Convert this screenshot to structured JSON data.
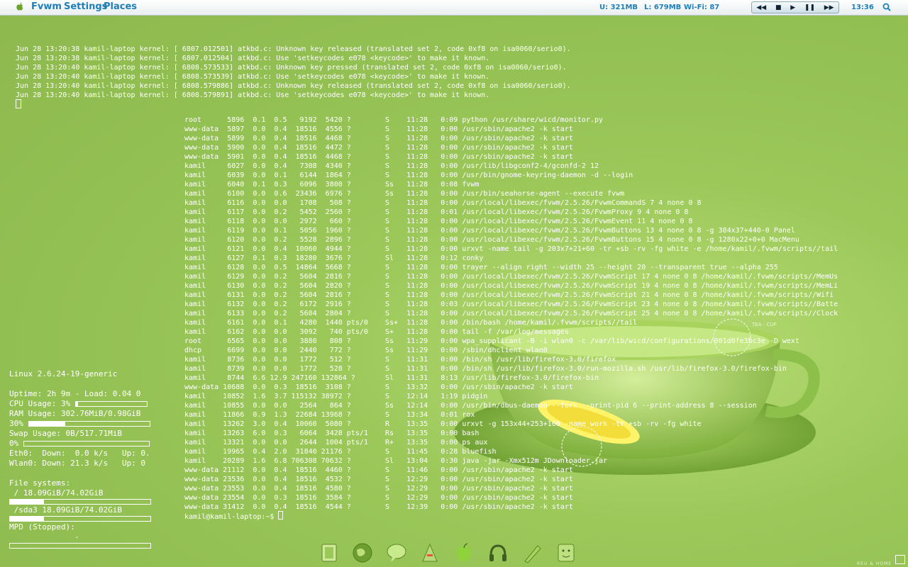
{
  "topbar": {
    "menus": [
      "Fvwm",
      "Settings",
      "Places"
    ],
    "user_mem": "U: 321MB",
    "load_mem": "L: 679MB",
    "wifi": "Wi-Fi: 87",
    "clock": "13:36",
    "media_buttons": [
      "rewind-icon",
      "stop-icon",
      "play-icon",
      "pause-icon",
      "forward-icon"
    ]
  },
  "kernel_log": [
    "Jun 28 13:20:38 kamil-laptop kernel: [ 6807.012501] atkbd.c: Unknown key released (translated set 2, code 0xf8 on isa0060/serio0).",
    "Jun 28 13:20:38 kamil-laptop kernel: [ 6807.012504] atkbd.c: Use 'setkeycodes e078 <keycode>' to make it known.",
    "Jun 28 13:20:40 kamil-laptop kernel: [ 6808.573533] atkbd.c: Unknown key pressed (translated set 2, code 0xf8 on isa0060/serio0).",
    "Jun 28 13:20:40 kamil-laptop kernel: [ 6808.573539] atkbd.c: Use 'setkeycodes e078 <keycode>' to make it known.",
    "Jun 28 13:20:40 kamil-laptop kernel: [ 6808.579886] atkbd.c: Unknown key released (translated set 2, code 0xf8 on isa0060/serio0).",
    "Jun 28 13:20:40 kamil-laptop kernel: [ 6808.579891] atkbd.c: Use 'setkeycodes e078 <keycode>' to make it known."
  ],
  "ps_output": [
    "root      5896  0.1  0.5   9192  5420 ?        S    11:28   0:09 python /usr/share/wicd/monitor.py",
    "www-data  5897  0.0  0.4  18516  4556 ?        S    11:28   0:00 /usr/sbin/apache2 -k start",
    "www-data  5899  0.0  0.4  18516  4468 ?        S    11:28   0:00 /usr/sbin/apache2 -k start",
    "www-data  5900  0.0  0.4  18516  4472 ?        S    11:28   0:00 /usr/sbin/apache2 -k start",
    "www-data  5901  0.0  0.4  18516  4468 ?        S    11:28   0:00 /usr/sbin/apache2 -k start",
    "kamil     6027  0.0  0.4   7308  4340 ?        S    11:28   0:00 /usr/lib/libgconf2-4/gconfd-2 12",
    "kamil     6039  0.0  0.1   6144  1864 ?        S    11:28   0:00 /usr/bin/gnome-keyring-daemon -d --login",
    "kamil     6040  0.1  0.3   6096  3800 ?        Ss   11:28   0:08 fvwm",
    "kamil     6100  0.0  0.6  23436  6976 ?        Ss   11:28   0:00 /usr/bin/seahorse-agent --execute fvwm",
    "kamil     6116  0.0  0.0   1708   508 ?        S    11:28   0:00 /usr/local/libexec/fvwm/2.5.26/FvwmCommandS 7 4 none 0 8",
    "kamil     6117  0.0  0.2   5452  2560 ?        S    11:28   0:01 /usr/local/libexec/fvwm/2.5.26/FvwmProxy 9 4 none 0 8",
    "kamil     6118  0.0  0.0   2972   660 ?        S    11:28   0:00 /usr/local/libexec/fvwm/2.5.26/FvwmEvent 11 4 none 0 8",
    "kamil     6119  0.0  0.1   5056  1960 ?        S    11:28   0:00 /usr/local/libexec/fvwm/2.5.26/FvwmButtons 13 4 none 0 8 -g 384x37+440-0 Panel",
    "kamil     6120  0.0  0.2   5528  2896 ?        S    11:28   0:00 /usr/local/libexec/fvwm/2.5.26/FvwmButtons 15 4 none 0 8 -g 1280x22+0+0 MacMenu",
    "kamil     6121  0.0  0.4  10060  4944 ?        S    11:28   0:00 urxvt -name tail -g 203x7+21+60 -tr +sb -rv -fg white -e /home/kamil/.fvwm/scripts//tail",
    "kamil     6127  0.1  0.3  18280  3676 ?        Sl   11:28   0:12 conky",
    "kamil     6128  0.0  0.5  14864  5668 ?        S    11:28   0:00 trayer --align right --width 25 --height 20 --transparent true --alpha 255",
    "kamil     6129  0.0  0.2   5604  2816 ?        S    11:28   0:00 /usr/local/libexec/fvwm/2.5.26/FvwmScript 17 4 none 0 8 /home/kamil/.fvwm/scripts//MemUs",
    "kamil     6130  0.0  0.2   5604  2820 ?        S    11:28   0:00 /usr/local/libexec/fvwm/2.5.26/FvwmScript 19 4 none 0 8 /home/kamil/.fvwm/scripts//MemLi",
    "kamil     6131  0.0  0.2   5604  2816 ?        S    11:28   0:00 /usr/local/libexec/fvwm/2.5.26/FvwmScript 21 4 none 0 8 /home/kamil/.fvwm/scripts//Wifi",
    "kamil     6132  0.0  0.2   6172  2916 ?        S    11:28   0:03 /usr/local/libexec/fvwm/2.5.26/FvwmScript 23 4 none 0 8 /home/kamil/.fvwm/scripts//Batte",
    "kamil     6133  0.0  0.2   5604  2804 ?        S    11:28   0:00 /usr/local/libexec/fvwm/2.5.26/FvwmScript 25 4 none 0 8 /home/kamil/.fvwm/scripts//Clock",
    "kamil     6161  0.0  0.1   4280  1440 pts/0    Ss+  11:28   0:00 /bin/bash /home/kamil/.fvwm/scripts//tail",
    "kamil     6162  0.0  0.0   3092   740 pts/0    S+   11:28   0:00 tail -f /var/log/messages",
    "root      6565  0.0  0.0   3880   808 ?        Ss   11:29   0:00 wpa_supplicant -B -i wlan0 -c /var/lib/wicd/configurations/001d0fe3bc3e -D wext",
    "dhcp      6699  0.0  0.0   2440   772 ?        Ss   11:29   0:00 /sbin/dhclient wlan0",
    "kamil     8736  0.0  0.0   1772   512 ?        S    11:31   0:00 /bin/sh /usr/lib/firefox-3.0/firefox",
    "kamil     8739  0.0  0.0   1772   528 ?        S    11:31   0:00 /bin/sh /usr/lib/firefox-3.0/run-mozilla.sh /usr/lib/firefox-3.0/firefox-bin",
    "kamil     8744  6.6 12.9 247160 132864 ?       Sl   11:31   8:13 /usr/lib/firefox-3.0/firefox-bin",
    "www-data 10688  0.0  0.3  18516  3108 ?        S    13:32   0:00 /usr/sbin/apache2 -k start",
    "kamil    10852  1.6  3.7 115132 38972 ?        S    12:14   1:19 pidgin",
    "kamil    10855  0.0  0.0   2564   864 ?        Ss   12:14   0:00 /usr/bin/dbus-daemon --fork --print-pid 6 --print-address 8 --session",
    "kamil    11866  0.9  1.3  22684 13968 ?        S    13:34   0:01 rox",
    "kamil    13262  3.0  0.4  10060  5080 ?        R    13:35   0:00 urxvt -g 153x44+253+160 -name work -tr +sb -rv -fg white",
    "kamil    13263  6.0  0.3   6064  3428 pts/1    Rs   13:35   0:00 bash",
    "kamil    13321  0.0  0.0   2644  1004 pts/1    R+   13:35   0:00 ps aux",
    "kamil    19965  0.4  2.0  31840 21176 ?        S    11:45   0:28 bluefish",
    "kamil    20289  1.6  6.8 706308 70632 ?        Sl   13:04   0:30 java -jar -Xmx512m JDownloader.jar",
    "www-data 21112  0.0  0.4  18516  4460 ?        S    11:46   0:00 /usr/sbin/apache2 -k start",
    "www-data 23536  0.0  0.4  18516  4532 ?        S    12:29   0:00 /usr/sbin/apache2 -k start",
    "www-data 23553  0.0  0.4  18516  4580 ?        S    12:29   0:00 /usr/sbin/apache2 -k start",
    "www-data 23554  0.0  0.3  18516  3584 ?        S    12:29   0:00 /usr/sbin/apache2 -k start",
    "www-data 31412  0.0  0.4  18516  4544 ?        S    12:39   0:00 /usr/sbin/apache2 -k start"
  ],
  "prompt": "kamil@kamil-laptop:~$ ",
  "conky": {
    "kernel": "Linux 2.6.24-19-generic",
    "uptime": "Uptime: 2h 9m - Load: 0.04 0",
    "cpu": "CPU Usage: 3%",
    "cpu_fraction": 0.03,
    "ram": "RAM Usage: 302.76MiB/0.98GiB",
    "ram_pct": "30%",
    "ram_fraction": 0.3,
    "swap": "Swap Usage: 0B/517.71MiB",
    "swap_pct": "0%",
    "swap_fraction": 0.0,
    "eth0": "Eth0:  Down:  0.0 k/s   Up: 0.",
    "wlan0": "Wlan0: Down: 21.3 k/s   Up: 0",
    "fs_header": "File systems:",
    "fs_root": " / 18.09GiB/74.02GiB",
    "fs_root_fraction": 0.244,
    "fs_sda3": " /sda3 18.09GiB/74.02GiB",
    "fs_sda3_fraction": 0.244,
    "mpd": "MPD (Stopped):",
    "mpd_dash": "-"
  },
  "wallpaper": {
    "cup_label": "TEA - CUP",
    "corner_text": "REU & HOME"
  },
  "dock": {
    "icons": [
      "file-manager-icon",
      "globe-icon",
      "chat-icon",
      "editor-icon",
      "apple-icon",
      "headphones-icon",
      "pen-icon",
      "finder-icon"
    ]
  },
  "colors": {
    "accent": "#1e7fb8",
    "background": "#9cc85a"
  }
}
